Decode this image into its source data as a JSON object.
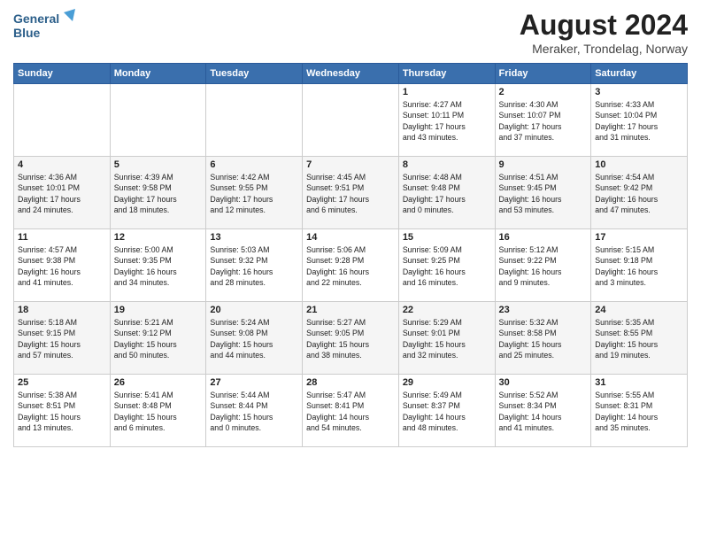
{
  "header": {
    "logo_line1": "General",
    "logo_line2": "Blue",
    "title": "August 2024",
    "subtitle": "Meraker, Trondelag, Norway"
  },
  "days_of_week": [
    "Sunday",
    "Monday",
    "Tuesday",
    "Wednesday",
    "Thursday",
    "Friday",
    "Saturday"
  ],
  "weeks": [
    [
      {
        "day": "",
        "info": ""
      },
      {
        "day": "",
        "info": ""
      },
      {
        "day": "",
        "info": ""
      },
      {
        "day": "",
        "info": ""
      },
      {
        "day": "1",
        "info": "Sunrise: 4:27 AM\nSunset: 10:11 PM\nDaylight: 17 hours\nand 43 minutes."
      },
      {
        "day": "2",
        "info": "Sunrise: 4:30 AM\nSunset: 10:07 PM\nDaylight: 17 hours\nand 37 minutes."
      },
      {
        "day": "3",
        "info": "Sunrise: 4:33 AM\nSunset: 10:04 PM\nDaylight: 17 hours\nand 31 minutes."
      }
    ],
    [
      {
        "day": "4",
        "info": "Sunrise: 4:36 AM\nSunset: 10:01 PM\nDaylight: 17 hours\nand 24 minutes."
      },
      {
        "day": "5",
        "info": "Sunrise: 4:39 AM\nSunset: 9:58 PM\nDaylight: 17 hours\nand 18 minutes."
      },
      {
        "day": "6",
        "info": "Sunrise: 4:42 AM\nSunset: 9:55 PM\nDaylight: 17 hours\nand 12 minutes."
      },
      {
        "day": "7",
        "info": "Sunrise: 4:45 AM\nSunset: 9:51 PM\nDaylight: 17 hours\nand 6 minutes."
      },
      {
        "day": "8",
        "info": "Sunrise: 4:48 AM\nSunset: 9:48 PM\nDaylight: 17 hours\nand 0 minutes."
      },
      {
        "day": "9",
        "info": "Sunrise: 4:51 AM\nSunset: 9:45 PM\nDaylight: 16 hours\nand 53 minutes."
      },
      {
        "day": "10",
        "info": "Sunrise: 4:54 AM\nSunset: 9:42 PM\nDaylight: 16 hours\nand 47 minutes."
      }
    ],
    [
      {
        "day": "11",
        "info": "Sunrise: 4:57 AM\nSunset: 9:38 PM\nDaylight: 16 hours\nand 41 minutes."
      },
      {
        "day": "12",
        "info": "Sunrise: 5:00 AM\nSunset: 9:35 PM\nDaylight: 16 hours\nand 34 minutes."
      },
      {
        "day": "13",
        "info": "Sunrise: 5:03 AM\nSunset: 9:32 PM\nDaylight: 16 hours\nand 28 minutes."
      },
      {
        "day": "14",
        "info": "Sunrise: 5:06 AM\nSunset: 9:28 PM\nDaylight: 16 hours\nand 22 minutes."
      },
      {
        "day": "15",
        "info": "Sunrise: 5:09 AM\nSunset: 9:25 PM\nDaylight: 16 hours\nand 16 minutes."
      },
      {
        "day": "16",
        "info": "Sunrise: 5:12 AM\nSunset: 9:22 PM\nDaylight: 16 hours\nand 9 minutes."
      },
      {
        "day": "17",
        "info": "Sunrise: 5:15 AM\nSunset: 9:18 PM\nDaylight: 16 hours\nand 3 minutes."
      }
    ],
    [
      {
        "day": "18",
        "info": "Sunrise: 5:18 AM\nSunset: 9:15 PM\nDaylight: 15 hours\nand 57 minutes."
      },
      {
        "day": "19",
        "info": "Sunrise: 5:21 AM\nSunset: 9:12 PM\nDaylight: 15 hours\nand 50 minutes."
      },
      {
        "day": "20",
        "info": "Sunrise: 5:24 AM\nSunset: 9:08 PM\nDaylight: 15 hours\nand 44 minutes."
      },
      {
        "day": "21",
        "info": "Sunrise: 5:27 AM\nSunset: 9:05 PM\nDaylight: 15 hours\nand 38 minutes."
      },
      {
        "day": "22",
        "info": "Sunrise: 5:29 AM\nSunset: 9:01 PM\nDaylight: 15 hours\nand 32 minutes."
      },
      {
        "day": "23",
        "info": "Sunrise: 5:32 AM\nSunset: 8:58 PM\nDaylight: 15 hours\nand 25 minutes."
      },
      {
        "day": "24",
        "info": "Sunrise: 5:35 AM\nSunset: 8:55 PM\nDaylight: 15 hours\nand 19 minutes."
      }
    ],
    [
      {
        "day": "25",
        "info": "Sunrise: 5:38 AM\nSunset: 8:51 PM\nDaylight: 15 hours\nand 13 minutes."
      },
      {
        "day": "26",
        "info": "Sunrise: 5:41 AM\nSunset: 8:48 PM\nDaylight: 15 hours\nand 6 minutes."
      },
      {
        "day": "27",
        "info": "Sunrise: 5:44 AM\nSunset: 8:44 PM\nDaylight: 15 hours\nand 0 minutes."
      },
      {
        "day": "28",
        "info": "Sunrise: 5:47 AM\nSunset: 8:41 PM\nDaylight: 14 hours\nand 54 minutes."
      },
      {
        "day": "29",
        "info": "Sunrise: 5:49 AM\nSunset: 8:37 PM\nDaylight: 14 hours\nand 48 minutes."
      },
      {
        "day": "30",
        "info": "Sunrise: 5:52 AM\nSunset: 8:34 PM\nDaylight: 14 hours\nand 41 minutes."
      },
      {
        "day": "31",
        "info": "Sunrise: 5:55 AM\nSunset: 8:31 PM\nDaylight: 14 hours\nand 35 minutes."
      }
    ]
  ]
}
